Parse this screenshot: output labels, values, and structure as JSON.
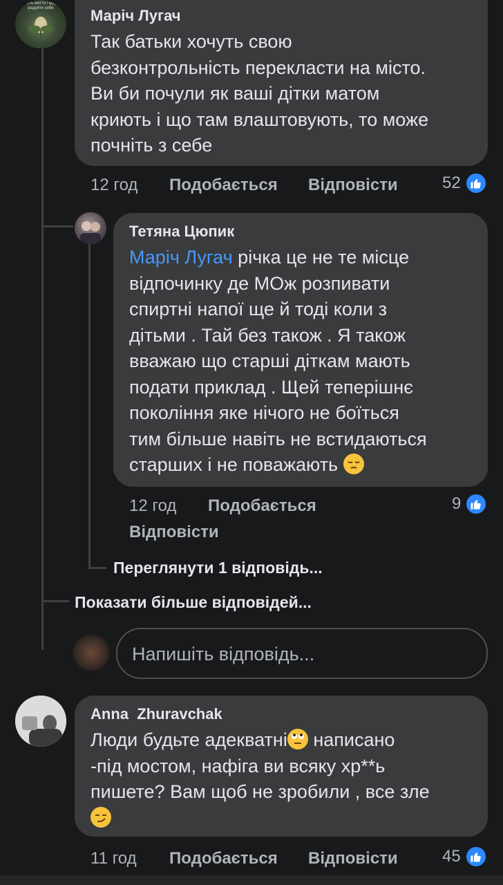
{
  "comments": [
    {
      "author": "Маріч Лугач",
      "avatar_caption": "Любіть життя і щодня радуйте себе",
      "lines": [
        "Так батьки хочуть свою",
        "безконтрольність перекласти на місто.",
        "Ви би почули як ваші дітки матом",
        "криють і що там влаштовують, то може",
        "почніть з себе"
      ],
      "time": "12 год",
      "like_label": "Подобається",
      "reply_label": "Відповісти",
      "reactions_count": "52"
    },
    {
      "author": "Тетяна Цюпик",
      "mention": "Маріч Лугач",
      "lines": [
        " річка це не те місце",
        "відпочинку де МОж розпивати",
        "спиртні напої ще й тоді коли з",
        "дітьми . Тай без також . Я також",
        "вважаю що старші діткам мають",
        "подати приклад . Щей теперішнє",
        "покоління яке нічого не боїться",
        "тим більше навіть не встидаються",
        "старших і не поважають "
      ],
      "emoji": "pensive-face",
      "time": "12 год",
      "like_label": "Подобається",
      "reply_label": "Відповісти",
      "reactions_count": "9",
      "view_replies": "Переглянути 1 відповідь..."
    },
    {
      "author": "Anna  Zhuravchak",
      "lines": [
        "Люди будьте адекватні",
        " написано",
        "-під мостом, нафіга ви всяку хр**ь",
        "пишете?  Вам щоб не зробили , все зле"
      ],
      "emojis": [
        "face-with-rolling-eyes",
        "smirking-face"
      ],
      "time": "11 год",
      "like_label": "Подобається",
      "reply_label": "Відповісти",
      "reactions_count": "45"
    }
  ],
  "show_more_replies": "Показати більше відповідей...",
  "reply_placeholder": "Напишіть відповідь...",
  "colors": {
    "background": "#18191a",
    "bubble": "#3a3b3c",
    "mention": "#4599ff",
    "like_blue": "#2d88ff",
    "secondary_text": "#b0b3b8"
  }
}
